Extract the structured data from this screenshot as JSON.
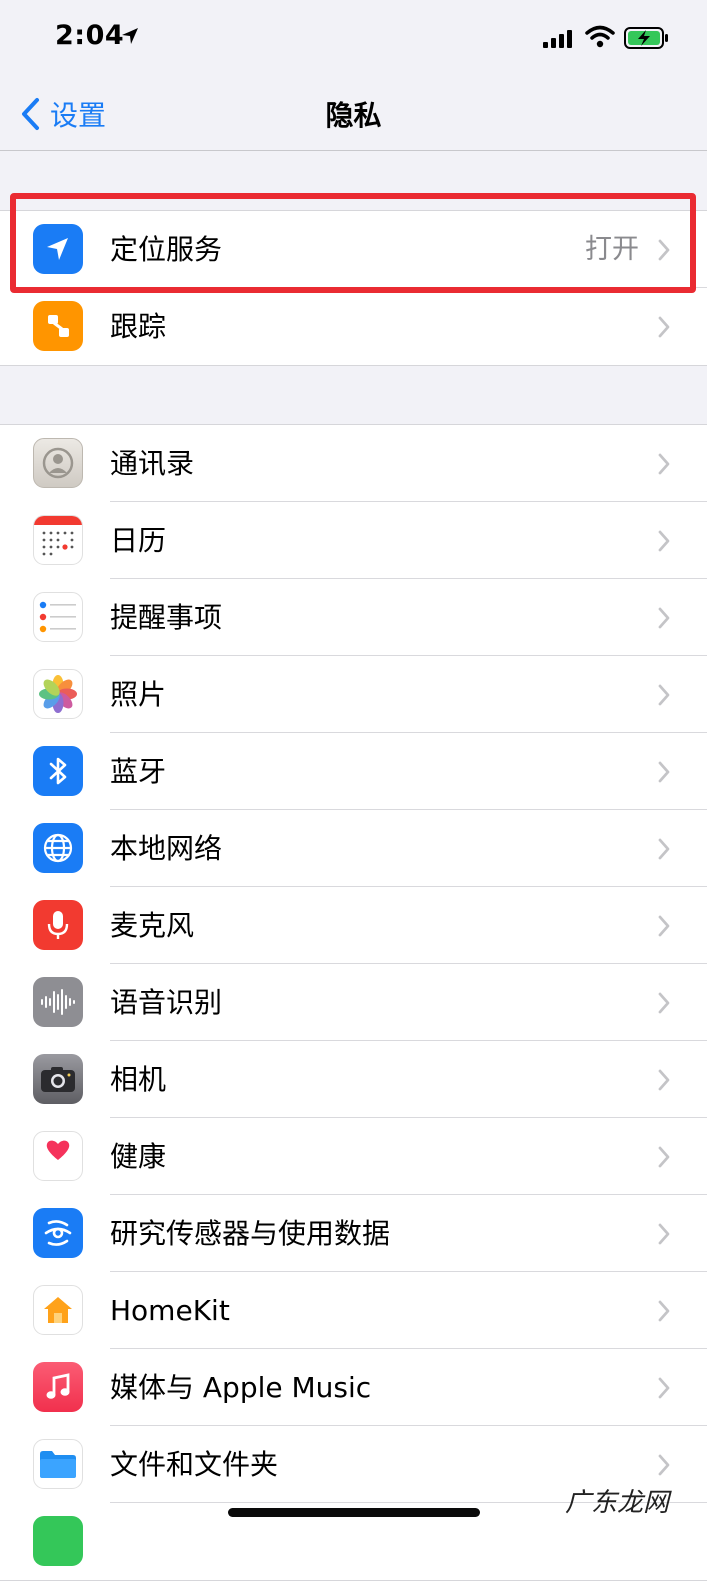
{
  "status": {
    "time": "2:04"
  },
  "nav": {
    "back_label": "设置",
    "title": "隐私"
  },
  "group1": [
    {
      "label": "定位服务",
      "value": "打开",
      "icon": "location-arrow-icon"
    },
    {
      "label": "跟踪",
      "icon": "tracking-icon"
    }
  ],
  "group2": [
    {
      "label": "通讯录",
      "icon": "contacts-icon"
    },
    {
      "label": "日历",
      "icon": "calendar-icon"
    },
    {
      "label": "提醒事项",
      "icon": "reminders-icon"
    },
    {
      "label": "照片",
      "icon": "photos-icon"
    },
    {
      "label": "蓝牙",
      "icon": "bluetooth-icon"
    },
    {
      "label": "本地网络",
      "icon": "globe-icon"
    },
    {
      "label": "麦克风",
      "icon": "microphone-icon"
    },
    {
      "label": "语音识别",
      "icon": "waveform-icon"
    },
    {
      "label": "相机",
      "icon": "camera-icon"
    },
    {
      "label": "健康",
      "icon": "heart-icon"
    },
    {
      "label": "研究传感器与使用数据",
      "icon": "research-icon"
    },
    {
      "label": "HomeKit",
      "icon": "home-icon"
    },
    {
      "label": "媒体与 Apple Music",
      "icon": "music-note-icon"
    },
    {
      "label": "文件和文件夹",
      "icon": "folder-icon"
    }
  ],
  "colors": {
    "accent": "#1a7cf5",
    "highlight": "#ea2b32",
    "secondary_text": "#8a8a8e"
  },
  "watermark": "广东龙网"
}
